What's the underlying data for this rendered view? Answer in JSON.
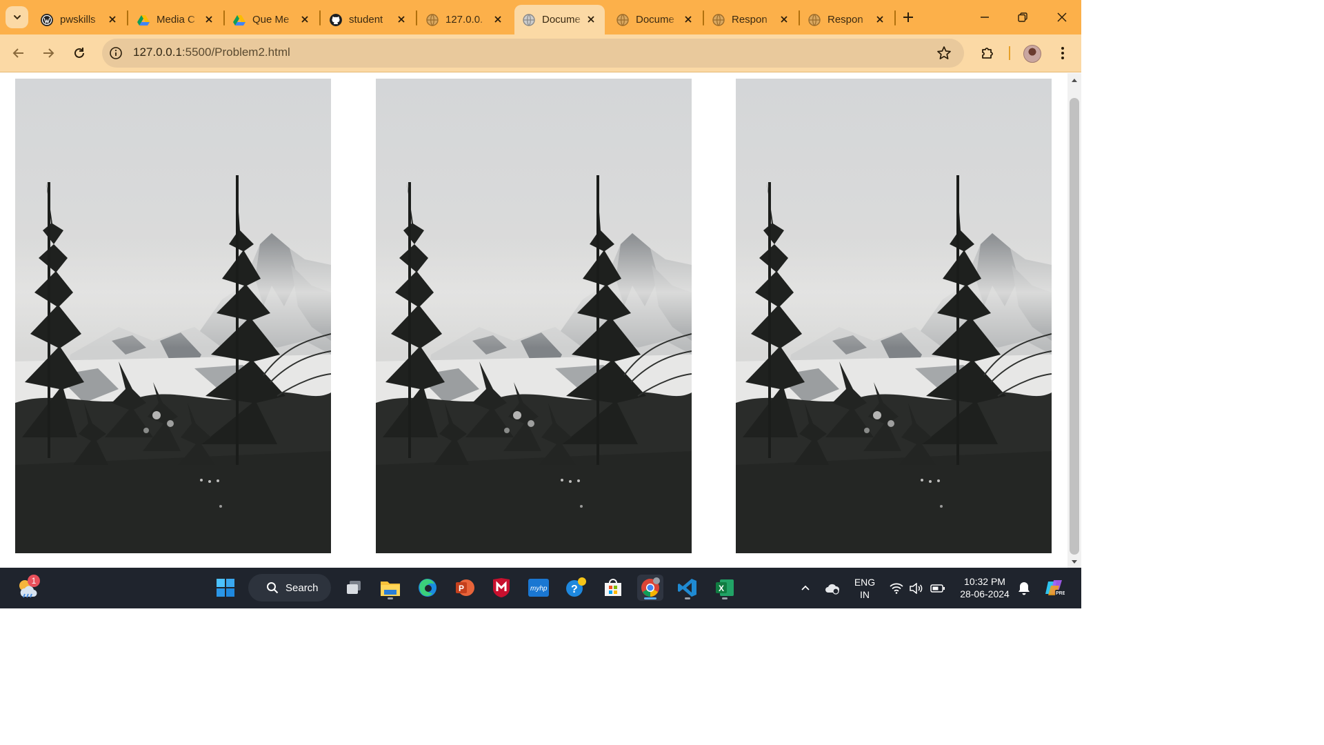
{
  "browser": {
    "tabs": [
      {
        "title": "pwskills",
        "favicon": "wordpress-icon",
        "active": false
      },
      {
        "title": "Media C",
        "favicon": "google-drive-icon",
        "active": false
      },
      {
        "title": "Que Me",
        "favicon": "google-drive-icon",
        "active": false
      },
      {
        "title": "student",
        "favicon": "github-icon",
        "active": false
      },
      {
        "title": "127.0.0.",
        "favicon": "globe-icon",
        "active": false
      },
      {
        "title": "Docume",
        "favicon": "globe-icon",
        "active": true
      },
      {
        "title": "Docume",
        "favicon": "globe-icon",
        "active": false
      },
      {
        "title": "Respon",
        "favicon": "globe-icon",
        "active": false
      },
      {
        "title": "Respon",
        "favicon": "globe-icon",
        "active": false
      }
    ],
    "address_bar": {
      "url_host": "127.0.0.1",
      "url_rest": ":5500/Problem2.html"
    },
    "colors": {
      "frame": "#fcb04a",
      "toolbar": "#fbd9a5",
      "omnibox": "#e9c99c"
    }
  },
  "page": {
    "images": [
      {
        "name": "forest-mountain-photo-1",
        "description_icon": "image"
      },
      {
        "name": "forest-mountain-photo-2",
        "description_icon": "image"
      },
      {
        "name": "forest-mountain-photo-3",
        "description_icon": "image"
      }
    ]
  },
  "taskbar": {
    "search_label": "Search",
    "weather_badge": "1",
    "apps": [
      "windows-start-icon",
      "task-view-icon",
      "file-explorer-icon",
      "edge-icon",
      "powerpoint-icon",
      "mcafee-icon",
      "myhp-icon",
      "help-icon",
      "store-icon",
      "chrome-icon",
      "vscode-icon",
      "excel-icon"
    ],
    "language": {
      "line1": "ENG",
      "line2": "IN"
    },
    "time": "10:32 PM",
    "date": "28-06-2024"
  }
}
